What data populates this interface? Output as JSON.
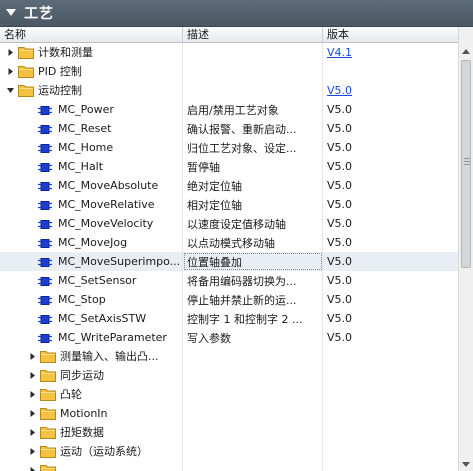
{
  "panel": {
    "title": "工艺"
  },
  "columns": {
    "name": "名称",
    "description": "描述",
    "version": "版本"
  },
  "rows": [
    {
      "kind": "folder",
      "level": 0,
      "expanded": false,
      "name": "计数和测量",
      "description": "",
      "version": "V4.1",
      "version_link": true
    },
    {
      "kind": "folder",
      "level": 0,
      "expanded": false,
      "name": "PID 控制",
      "description": "",
      "version": "",
      "version_link": false
    },
    {
      "kind": "folder",
      "level": 0,
      "expanded": true,
      "name": "运动控制",
      "description": "",
      "version": "V5.0",
      "version_link": true
    },
    {
      "kind": "block",
      "level": 1,
      "name": "MC_Power",
      "description": "启用/禁用工艺对象",
      "version": "V5.0"
    },
    {
      "kind": "block",
      "level": 1,
      "name": "MC_Reset",
      "description": "确认报警、重新启动...",
      "version": "V5.0"
    },
    {
      "kind": "block",
      "level": 1,
      "name": "MC_Home",
      "description": "归位工艺对象、设定...",
      "version": "V5.0"
    },
    {
      "kind": "block",
      "level": 1,
      "name": "MC_Halt",
      "description": "暂停轴",
      "version": "V5.0"
    },
    {
      "kind": "block",
      "level": 1,
      "name": "MC_MoveAbsolute",
      "description": "绝对定位轴",
      "version": "V5.0"
    },
    {
      "kind": "block",
      "level": 1,
      "name": "MC_MoveRelative",
      "description": "相对定位轴",
      "version": "V5.0"
    },
    {
      "kind": "block",
      "level": 1,
      "name": "MC_MoveVelocity",
      "description": "以速度设定值移动轴",
      "version": "V5.0"
    },
    {
      "kind": "block",
      "level": 1,
      "name": "MC_MoveJog",
      "description": "以点动模式移动轴",
      "version": "V5.0"
    },
    {
      "kind": "block",
      "level": 1,
      "name": "MC_MoveSuperimpo...",
      "description": "位置轴叠加",
      "version": "V5.0",
      "selected": true
    },
    {
      "kind": "block",
      "level": 1,
      "name": "MC_SetSensor",
      "description": "将备用编码器切换为...",
      "version": "V5.0"
    },
    {
      "kind": "block",
      "level": 1,
      "name": "MC_Stop",
      "description": "停止轴并禁止新的运...",
      "version": "V5.0"
    },
    {
      "kind": "block",
      "level": 1,
      "name": "MC_SetAxisSTW",
      "description": "控制字 1 和控制字 2 ...",
      "version": "V5.0"
    },
    {
      "kind": "block",
      "level": 1,
      "name": "MC_WriteParameter",
      "description": "写入参数",
      "version": "V5.0"
    },
    {
      "kind": "folder",
      "level": 1,
      "expanded": false,
      "name": "测量输入、输出凸...",
      "description": "",
      "version": ""
    },
    {
      "kind": "folder",
      "level": 1,
      "expanded": false,
      "name": "同步运动",
      "description": "",
      "version": ""
    },
    {
      "kind": "folder",
      "level": 1,
      "expanded": false,
      "name": "凸轮",
      "description": "",
      "version": ""
    },
    {
      "kind": "folder",
      "level": 1,
      "expanded": false,
      "name": "MotionIn",
      "description": "",
      "version": ""
    },
    {
      "kind": "folder",
      "level": 1,
      "expanded": false,
      "name": "扭矩数据",
      "description": "",
      "version": ""
    },
    {
      "kind": "folder",
      "level": 1,
      "expanded": false,
      "name": "运动（运动系统）",
      "description": "",
      "version": ""
    },
    {
      "kind": "folder",
      "level": 1,
      "expanded": false,
      "name": "",
      "description": "",
      "version": ""
    }
  ],
  "icons": {
    "collapse": "collapse-triangle-icon",
    "expand": "expand-arrow-icon",
    "collapse_node": "collapse-arrow-icon",
    "folder": "folder-icon",
    "block": "function-block-icon"
  },
  "colors": {
    "header_bg": "#4f5d69",
    "folder": "#f5c143",
    "block": "#1d3fcf",
    "link": "#1a4bd6",
    "selected_row": "#e8eef4"
  }
}
